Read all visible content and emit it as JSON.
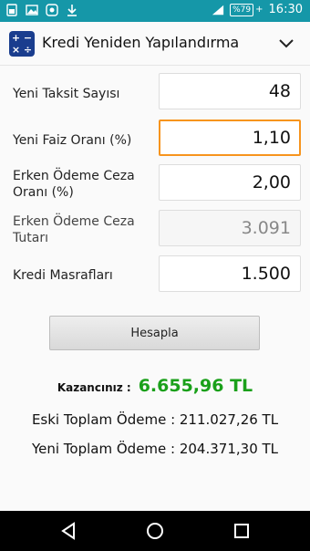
{
  "status": {
    "battery": "%79",
    "time": "16:30"
  },
  "app": {
    "title": "Kredi Yeniden Yapılandırma"
  },
  "form": {
    "installments": {
      "label": "Yeni Taksit Sayısı",
      "value": "48"
    },
    "interest": {
      "label": "Yeni Faiz Oranı (%)",
      "value": "1,10"
    },
    "penalty_rate": {
      "label": "Erken Ödeme Ceza Oranı (%)",
      "value": "2,00"
    },
    "penalty_amount": {
      "label": "Erken Ödeme Ceza Tutarı",
      "value": "3.091"
    },
    "fees": {
      "label": "Kredi Masrafları",
      "value": "1.500"
    }
  },
  "actions": {
    "calculate_label": "Hesapla"
  },
  "results": {
    "gain_label": "Kazancınız :",
    "gain_value": "6.655,96 TL",
    "old_total": "Eski Toplam Ödeme : 211.027,26 TL",
    "new_total": "Yeni Toplam Ödeme : 204.371,30 TL"
  },
  "colors": {
    "status_bar": "#1597a8",
    "focus": "#f7941d",
    "gain": "#1aa01a",
    "app_icon": "#1a3d8e"
  }
}
